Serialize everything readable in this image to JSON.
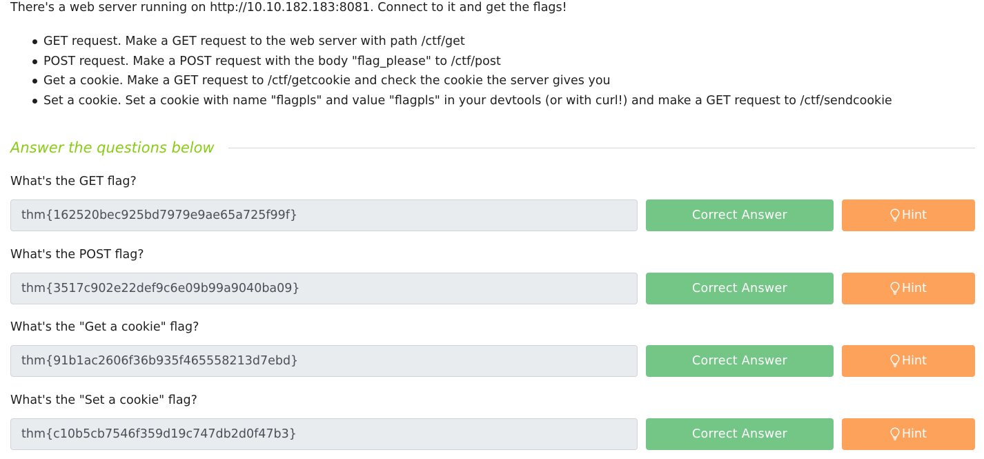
{
  "intro": "There's a web server running on http://10.10.182.183:8081. Connect to it and get the flags!",
  "tasks": [
    "GET request. Make a GET request to the web server with path /ctf/get",
    "POST request. Make a POST request with the body \"flag_please\" to /ctf/post",
    "Get a cookie. Make a GET request to /ctf/getcookie and check the cookie the server gives you",
    "Set a cookie. Set a cookie with name \"flagpls\" and value \"flagpls\" in your devtools (or with curl!) and make a GET request to /ctf/sendcookie"
  ],
  "section_title": "Answer the questions below",
  "questions": [
    {
      "label": "What's the GET flag?",
      "answer": "thm{162520bec925bd7979e9ae65a725f99f}",
      "status_label": "Correct Answer",
      "hint_label": "Hint"
    },
    {
      "label": "What's the POST flag?",
      "answer": "thm{3517c902e22def9c6e09b99a9040ba09}",
      "status_label": "Correct Answer",
      "hint_label": "Hint"
    },
    {
      "label": "What's the \"Get a cookie\" flag?",
      "answer": "thm{91b1ac2606f36b935f465558213d7ebd}",
      "status_label": "Correct Answer",
      "hint_label": "Hint"
    },
    {
      "label": "What's the \"Set a cookie\" flag?",
      "answer": "thm{c10b5cb7546f359d19c747db2d0f47b3}",
      "status_label": "Correct Answer",
      "hint_label": "Hint"
    }
  ],
  "icons": {
    "hint": "lightbulb-icon"
  },
  "colors": {
    "accent": "#88cc14",
    "correct": "#73c686",
    "hint": "#fda25b",
    "input_bg": "#e9ecef"
  }
}
